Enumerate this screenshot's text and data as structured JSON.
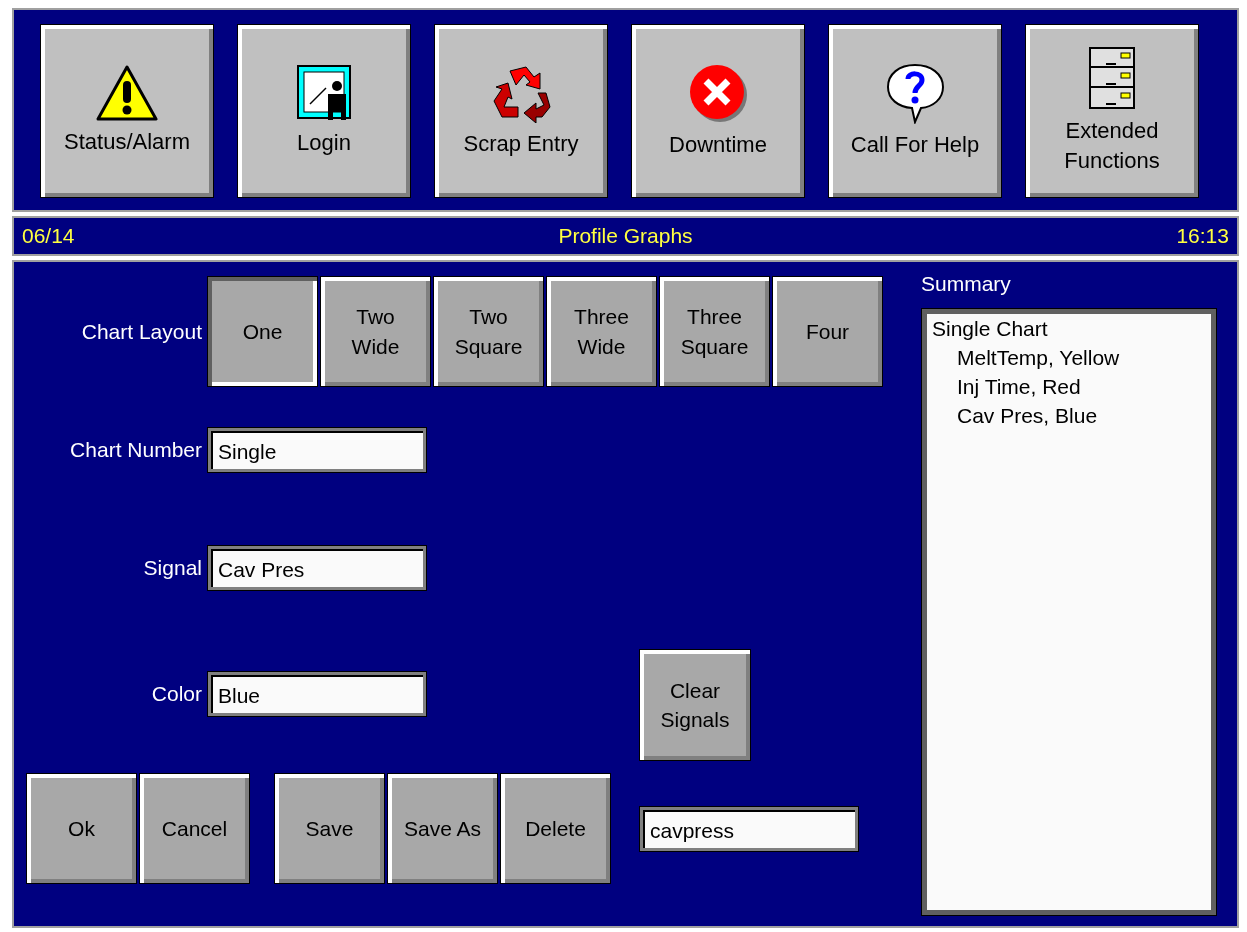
{
  "toolbar": [
    {
      "label": "Status/Alarm"
    },
    {
      "label": "Login"
    },
    {
      "label": "Scrap Entry"
    },
    {
      "label": "Downtime"
    },
    {
      "label": "Call For Help"
    },
    {
      "label": "Extended Functions"
    }
  ],
  "status_bar": {
    "date": "06/14",
    "title": "Profile Graphs",
    "time": "16:13"
  },
  "chart_layout": {
    "label": "Chart Layout",
    "options": [
      {
        "label": "One",
        "selected": true
      },
      {
        "label": "Two Wide",
        "selected": false
      },
      {
        "label": "Two Square",
        "selected": false
      },
      {
        "label": "Three Wide",
        "selected": false
      },
      {
        "label": "Three Square",
        "selected": false
      },
      {
        "label": "Four",
        "selected": false
      }
    ]
  },
  "fields": [
    {
      "label": "Chart Number",
      "value": "Single"
    },
    {
      "label": "Signal",
      "value": "Cav Pres"
    },
    {
      "label": "Color",
      "value": "Blue"
    }
  ],
  "clear_button": "Clear Signals",
  "bottom_buttons": [
    [
      "Ok",
      "Cancel"
    ],
    [
      "Save",
      "Save As",
      "Delete"
    ]
  ],
  "filename": {
    "value": "cavpress"
  },
  "summary": {
    "title": "Summary",
    "items": [
      {
        "label": "Single Chart",
        "children": [
          {
            "label": "MeltTemp, Yellow"
          },
          {
            "label": "Inj Time, Red"
          },
          {
            "label": "Cav Pres, Blue"
          }
        ]
      }
    ]
  }
}
